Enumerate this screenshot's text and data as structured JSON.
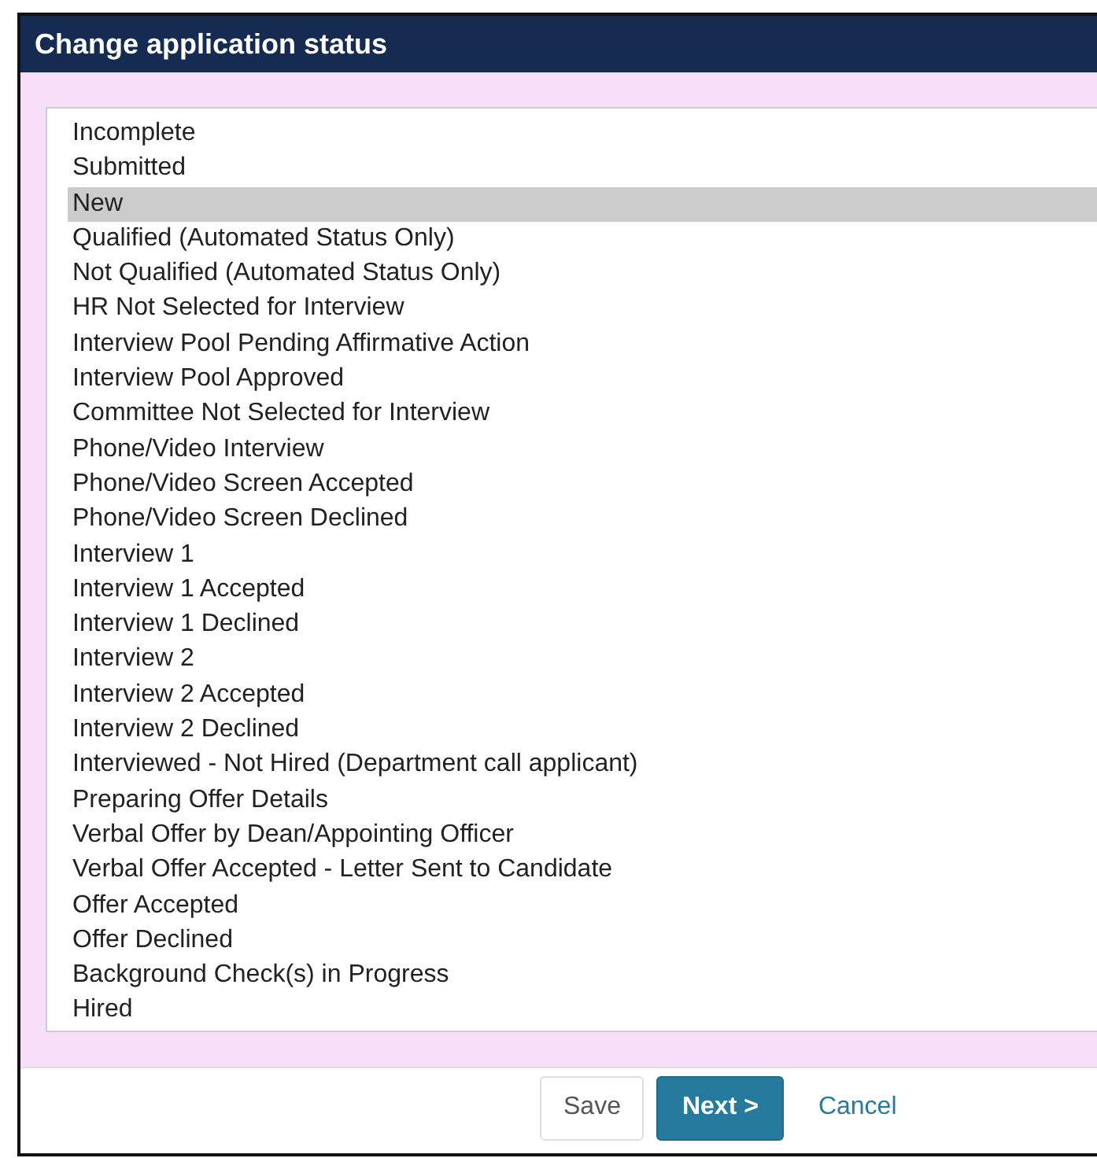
{
  "dialog": {
    "title": "Change application status"
  },
  "statuses": [
    {
      "label": "Incomplete",
      "selected": false
    },
    {
      "label": "Submitted",
      "selected": false
    },
    {
      "label": "New",
      "selected": true
    },
    {
      "label": "Qualified (Automated Status Only)",
      "selected": false
    },
    {
      "label": "Not Qualified (Automated Status Only)",
      "selected": false
    },
    {
      "label": "HR Not Selected for Interview",
      "selected": false
    },
    {
      "label": "Interview Pool Pending Affirmative Action",
      "selected": false
    },
    {
      "label": "Interview Pool Approved",
      "selected": false
    },
    {
      "label": "Committee Not Selected for Interview",
      "selected": false
    },
    {
      "label": "Phone/Video Interview",
      "selected": false
    },
    {
      "label": "Phone/Video Screen Accepted",
      "selected": false
    },
    {
      "label": "Phone/Video Screen Declined",
      "selected": false
    },
    {
      "label": "Interview 1",
      "selected": false
    },
    {
      "label": "Interview 1 Accepted",
      "selected": false
    },
    {
      "label": "Interview 1 Declined",
      "selected": false
    },
    {
      "label": "Interview 2",
      "selected": false
    },
    {
      "label": "Interview 2 Accepted",
      "selected": false
    },
    {
      "label": "Interview 2 Declined",
      "selected": false
    },
    {
      "label": "Interviewed - Not Hired (Department call applicant)",
      "selected": false
    },
    {
      "label": "Preparing Offer Details",
      "selected": false
    },
    {
      "label": "Verbal Offer by Dean/Appointing Officer",
      "selected": false
    },
    {
      "label": "Verbal Offer Accepted - Letter Sent to Candidate",
      "selected": false
    },
    {
      "label": "Offer Accepted",
      "selected": false
    },
    {
      "label": "Offer Declined",
      "selected": false
    },
    {
      "label": "Background Check(s) in Progress",
      "selected": false
    },
    {
      "label": "Hired",
      "selected": false
    }
  ],
  "buttons": [
    {
      "label": "Save",
      "kind": "secondary"
    },
    {
      "label": "Next >",
      "kind": "primary"
    },
    {
      "label": "Cancel",
      "kind": "link"
    }
  ]
}
